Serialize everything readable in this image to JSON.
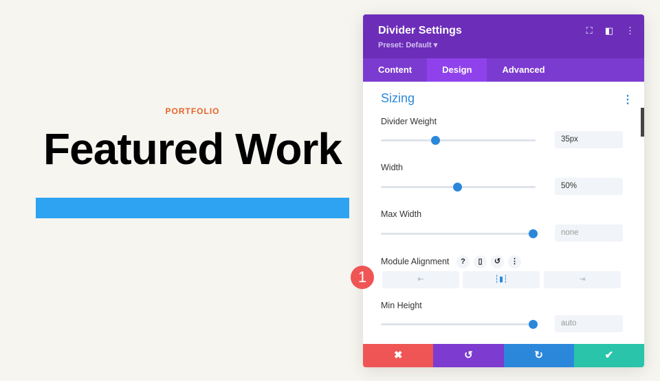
{
  "page": {
    "eyebrow": "PORTFOLIO",
    "title": "Featured Work"
  },
  "panel": {
    "title": "Divider Settings",
    "preset": "Preset: Default ▾",
    "icons": [
      "expand-icon",
      "sidebar-icon",
      "more-icon"
    ],
    "tabs": [
      {
        "label": "Content"
      },
      {
        "label": "Design"
      },
      {
        "label": "Advanced"
      }
    ],
    "section": "Sizing",
    "fields": [
      {
        "label": "Divider Weight",
        "value": "35px",
        "slider": 35
      },
      {
        "label": "Width",
        "value": "50%",
        "slider": 50
      },
      {
        "label": "Max Width",
        "value": "none",
        "slider": 100
      },
      {
        "label": "Min Height",
        "value": "auto",
        "slider": 100
      }
    ],
    "module_alignment": {
      "label": "Module Alignment",
      "options": [
        "left",
        "center",
        "right"
      ],
      "selected": "center"
    },
    "footer": [
      "cancel",
      "undo",
      "redo",
      "save"
    ]
  },
  "badge": "1",
  "colors": {
    "header": "#6c2eb9",
    "accent": "#2b87da",
    "divider": "#2ea3f2",
    "eyebrow": "#e8632b"
  }
}
